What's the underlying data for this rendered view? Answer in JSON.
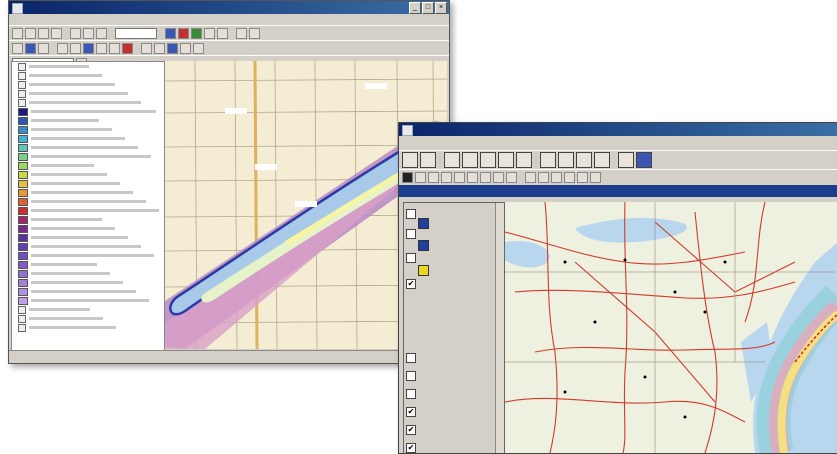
{
  "caption": {
    "line1": "",
    "line2": ""
  },
  "logo_text": "",
  "window1": {
    "title": "",
    "menu": [],
    "status": ""
  },
  "window2": {
    "title": "",
    "menu": [],
    "view_title": "",
    "layers": [
      {
        "label": "",
        "checked": false
      },
      {
        "label": "",
        "checked": false
      },
      {
        "label": "",
        "checked": false
      },
      {
        "label": "",
        "checked": true
      },
      {
        "label": "",
        "checked": false
      },
      {
        "label": "",
        "checked": false
      },
      {
        "label": "",
        "checked": false
      },
      {
        "label": "",
        "checked": true
      },
      {
        "label": "",
        "checked": true
      },
      {
        "label": "",
        "checked": true
      },
      {
        "label": "",
        "checked": true
      }
    ],
    "populated_places": [],
    "map_labels": {
      "city": ""
    }
  },
  "colors": {
    "logo_green": "#14a83c",
    "title_bar": "#0a246a",
    "plume_outline": "#2a3aa8"
  }
}
